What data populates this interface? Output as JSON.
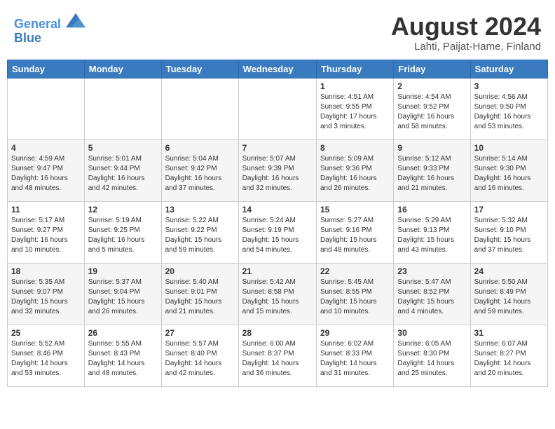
{
  "header": {
    "logo_line1": "General",
    "logo_line2": "Blue",
    "month_year": "August 2024",
    "location": "Lahti, Paijat-Hame, Finland"
  },
  "weekdays": [
    "Sunday",
    "Monday",
    "Tuesday",
    "Wednesday",
    "Thursday",
    "Friday",
    "Saturday"
  ],
  "weeks": [
    [
      {
        "day": "",
        "info": ""
      },
      {
        "day": "",
        "info": ""
      },
      {
        "day": "",
        "info": ""
      },
      {
        "day": "",
        "info": ""
      },
      {
        "day": "1",
        "info": "Sunrise: 4:51 AM\nSunset: 9:55 PM\nDaylight: 17 hours\nand 3 minutes."
      },
      {
        "day": "2",
        "info": "Sunrise: 4:54 AM\nSunset: 9:52 PM\nDaylight: 16 hours\nand 58 minutes."
      },
      {
        "day": "3",
        "info": "Sunrise: 4:56 AM\nSunset: 9:50 PM\nDaylight: 16 hours\nand 53 minutes."
      }
    ],
    [
      {
        "day": "4",
        "info": "Sunrise: 4:59 AM\nSunset: 9:47 PM\nDaylight: 16 hours\nand 48 minutes."
      },
      {
        "day": "5",
        "info": "Sunrise: 5:01 AM\nSunset: 9:44 PM\nDaylight: 16 hours\nand 42 minutes."
      },
      {
        "day": "6",
        "info": "Sunrise: 5:04 AM\nSunset: 9:42 PM\nDaylight: 16 hours\nand 37 minutes."
      },
      {
        "day": "7",
        "info": "Sunrise: 5:07 AM\nSunset: 9:39 PM\nDaylight: 16 hours\nand 32 minutes."
      },
      {
        "day": "8",
        "info": "Sunrise: 5:09 AM\nSunset: 9:36 PM\nDaylight: 16 hours\nand 26 minutes."
      },
      {
        "day": "9",
        "info": "Sunrise: 5:12 AM\nSunset: 9:33 PM\nDaylight: 16 hours\nand 21 minutes."
      },
      {
        "day": "10",
        "info": "Sunrise: 5:14 AM\nSunset: 9:30 PM\nDaylight: 16 hours\nand 16 minutes."
      }
    ],
    [
      {
        "day": "11",
        "info": "Sunrise: 5:17 AM\nSunset: 9:27 PM\nDaylight: 16 hours\nand 10 minutes."
      },
      {
        "day": "12",
        "info": "Sunrise: 5:19 AM\nSunset: 9:25 PM\nDaylight: 16 hours\nand 5 minutes."
      },
      {
        "day": "13",
        "info": "Sunrise: 5:22 AM\nSunset: 9:22 PM\nDaylight: 15 hours\nand 59 minutes."
      },
      {
        "day": "14",
        "info": "Sunrise: 5:24 AM\nSunset: 9:19 PM\nDaylight: 15 hours\nand 54 minutes."
      },
      {
        "day": "15",
        "info": "Sunrise: 5:27 AM\nSunset: 9:16 PM\nDaylight: 15 hours\nand 48 minutes."
      },
      {
        "day": "16",
        "info": "Sunrise: 5:29 AM\nSunset: 9:13 PM\nDaylight: 15 hours\nand 43 minutes."
      },
      {
        "day": "17",
        "info": "Sunrise: 5:32 AM\nSunset: 9:10 PM\nDaylight: 15 hours\nand 37 minutes."
      }
    ],
    [
      {
        "day": "18",
        "info": "Sunrise: 5:35 AM\nSunset: 9:07 PM\nDaylight: 15 hours\nand 32 minutes."
      },
      {
        "day": "19",
        "info": "Sunrise: 5:37 AM\nSunset: 9:04 PM\nDaylight: 15 hours\nand 26 minutes."
      },
      {
        "day": "20",
        "info": "Sunrise: 5:40 AM\nSunset: 9:01 PM\nDaylight: 15 hours\nand 21 minutes."
      },
      {
        "day": "21",
        "info": "Sunrise: 5:42 AM\nSunset: 8:58 PM\nDaylight: 15 hours\nand 15 minutes."
      },
      {
        "day": "22",
        "info": "Sunrise: 5:45 AM\nSunset: 8:55 PM\nDaylight: 15 hours\nand 10 minutes."
      },
      {
        "day": "23",
        "info": "Sunrise: 5:47 AM\nSunset: 8:52 PM\nDaylight: 15 hours\nand 4 minutes."
      },
      {
        "day": "24",
        "info": "Sunrise: 5:50 AM\nSunset: 8:49 PM\nDaylight: 14 hours\nand 59 minutes."
      }
    ],
    [
      {
        "day": "25",
        "info": "Sunrise: 5:52 AM\nSunset: 8:46 PM\nDaylight: 14 hours\nand 53 minutes."
      },
      {
        "day": "26",
        "info": "Sunrise: 5:55 AM\nSunset: 8:43 PM\nDaylight: 14 hours\nand 48 minutes."
      },
      {
        "day": "27",
        "info": "Sunrise: 5:57 AM\nSunset: 8:40 PM\nDaylight: 14 hours\nand 42 minutes."
      },
      {
        "day": "28",
        "info": "Sunrise: 6:00 AM\nSunset: 8:37 PM\nDaylight: 14 hours\nand 36 minutes."
      },
      {
        "day": "29",
        "info": "Sunrise: 6:02 AM\nSunset: 8:33 PM\nDaylight: 14 hours\nand 31 minutes."
      },
      {
        "day": "30",
        "info": "Sunrise: 6:05 AM\nSunset: 8:30 PM\nDaylight: 14 hours\nand 25 minutes."
      },
      {
        "day": "31",
        "info": "Sunrise: 6:07 AM\nSunset: 8:27 PM\nDaylight: 14 hours\nand 20 minutes."
      }
    ]
  ]
}
